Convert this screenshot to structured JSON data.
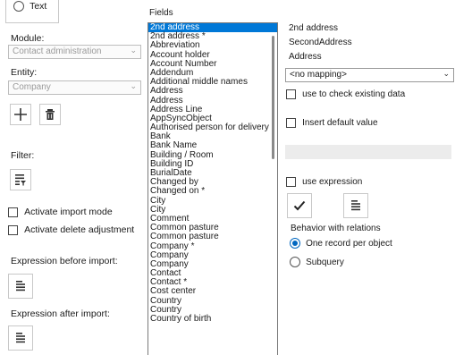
{
  "left": {
    "text_option": "Text",
    "module_label": "Module:",
    "module_value": "Contact administration",
    "entity_label": "Entity:",
    "entity_value": "Company",
    "filter_label": "Filter:",
    "activate_import_mode": "Activate import mode",
    "activate_delete_adjustment": "Activate delete adjustment",
    "expr_before_label": "Expression before import:",
    "expr_after_label": "Expression after import:"
  },
  "fields": {
    "title": "Fields",
    "items": [
      "2nd address",
      "2nd address *",
      "Abbreviation",
      "Account holder",
      "Account Number",
      "Addendum",
      "Additional middle names",
      "Address",
      "Address",
      "Address Line",
      "AppSyncObject",
      "Authorised person for delivery",
      "Bank",
      "Bank Name",
      "Building / Room",
      "Building ID",
      "BurialDate",
      "Changed by",
      "Changed on *",
      "City",
      "City",
      "Comment",
      "Common pasture",
      "Common pasture",
      "Company *",
      "Company",
      "Company",
      "Contact",
      "Contact *",
      "Cost center",
      "Country",
      "Country",
      "Country of birth"
    ],
    "selected_index": 0
  },
  "right": {
    "info_1": "2nd address",
    "info_2": "SecondAddress",
    "info_3": "Address",
    "mapping_value": "<no mapping>",
    "check_existing": "use to check existing data",
    "insert_default": "Insert default value",
    "use_expression": "use expression",
    "behavior_title": "Behavior with relations",
    "one_record": "One record per object",
    "subquery": "Subquery"
  },
  "icons": {
    "add": "plus-icon",
    "delete": "trash-icon",
    "filter": "filter-icon",
    "expression": "document-lines-icon",
    "confirm": "checkmark-icon"
  },
  "colors": {
    "selection": "#0078d7",
    "radio_accent": "#0067c0"
  }
}
